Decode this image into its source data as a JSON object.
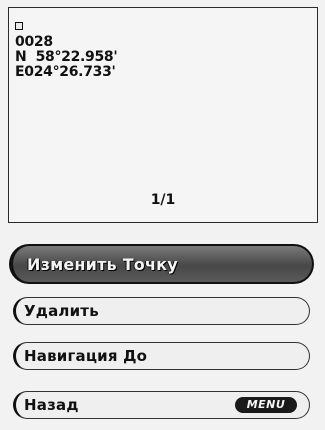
{
  "waypoint": {
    "symbol_icon": "waypoint-flag-icon",
    "name": "0028",
    "latitude": "N  58°22.958'",
    "longitude": "E024°26.733'"
  },
  "page_indicator": "1/1",
  "menu": {
    "selected_index": 0,
    "items": [
      {
        "label": "Изменить Точку"
      },
      {
        "label": "Удалить"
      },
      {
        "label": "Навигация До"
      },
      {
        "label": "Назад",
        "key_badge": "MENU"
      }
    ]
  },
  "colors": {
    "selected_fill": "#474747",
    "selected_text": "#f4f4f4",
    "item_fill": "#efefef",
    "text": "#111111",
    "badge_fill": "#1a1a1a"
  }
}
